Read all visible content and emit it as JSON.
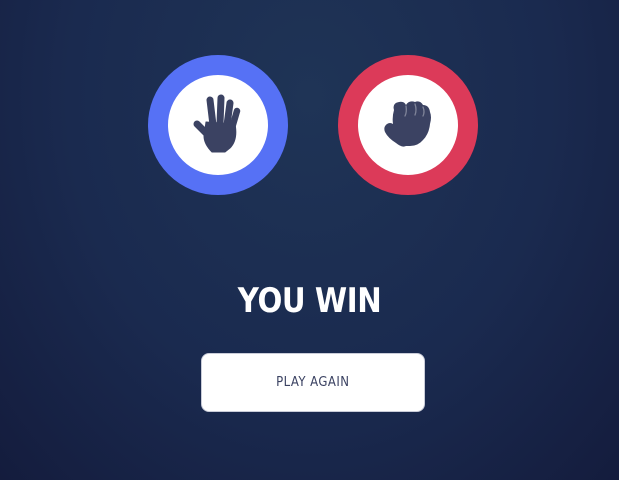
{
  "game": {
    "player_pick": {
      "name": "paper",
      "icon": "paper-hand-icon",
      "ring_color": "#5671f5"
    },
    "house_pick": {
      "name": "rock",
      "icon": "rock-fist-icon",
      "ring_color": "#dc3a59"
    }
  },
  "result": {
    "text": "YOU WIN"
  },
  "actions": {
    "play_again_label": "PLAY AGAIN"
  },
  "colors": {
    "background_top": "#1f3456",
    "background_bottom": "#141c3d",
    "icon_fill": "#3b4262",
    "text": "#ffffff"
  }
}
